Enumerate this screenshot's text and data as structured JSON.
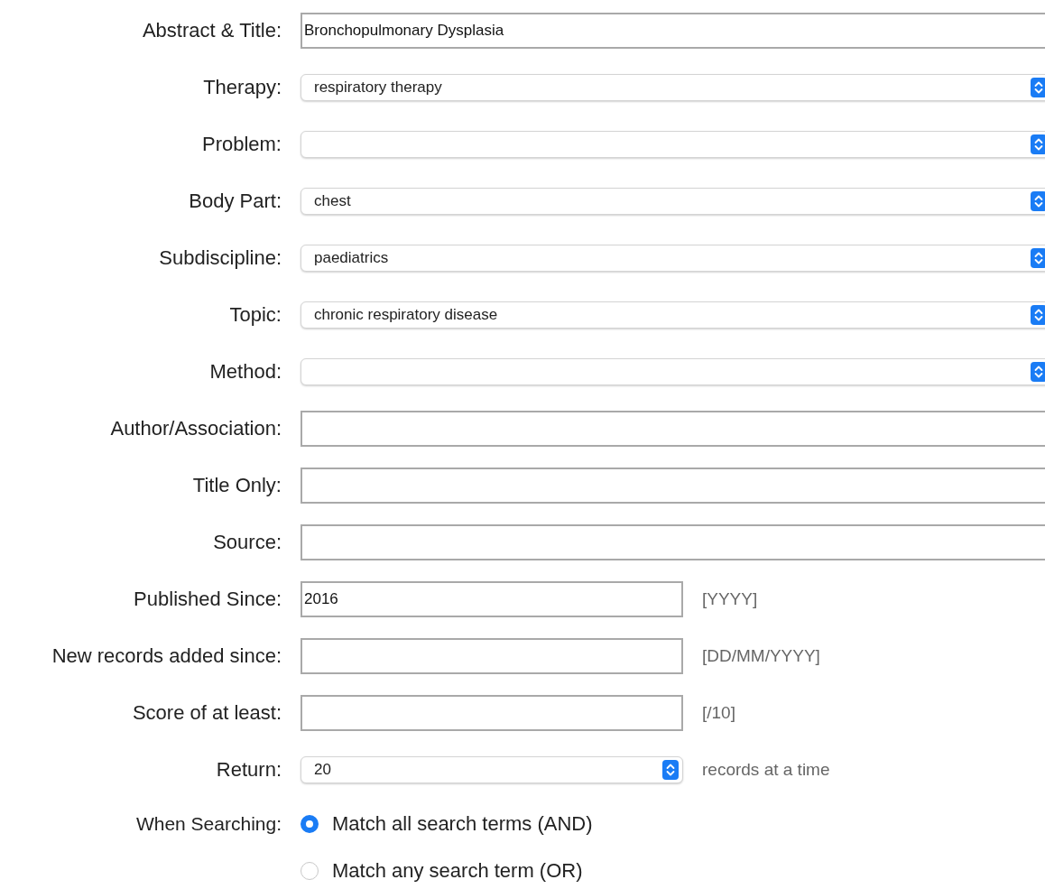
{
  "fields": [
    {
      "label": "Abstract & Title:",
      "kind": "text",
      "value": "Bronchopulmonary Dysplasia"
    },
    {
      "label": "Therapy:",
      "kind": "select",
      "value": "respiratory therapy"
    },
    {
      "label": "Problem:",
      "kind": "select"
    },
    {
      "label": "Body Part:",
      "kind": "select",
      "value": "chest"
    },
    {
      "label": "Subdiscipline:",
      "kind": "select",
      "value": "paediatrics"
    },
    {
      "label": "Topic:",
      "kind": "select",
      "value": "chronic respiratory disease"
    },
    {
      "label": "Method:",
      "kind": "select"
    },
    {
      "label": "Author/Association:",
      "kind": "text"
    },
    {
      "label": "Title Only:",
      "kind": "text"
    },
    {
      "label": "Source:",
      "kind": "text"
    },
    {
      "label": "Published Since:",
      "kind": "text",
      "value": "2016",
      "hint": "[YYYY]"
    },
    {
      "label": "New records added since:",
      "kind": "text",
      "hint": "[DD/MM/YYYY]"
    },
    {
      "label": "Score of at least:",
      "kind": "text",
      "hint": "[/10]"
    },
    {
      "label": "Return:",
      "kind": "select",
      "value": "20",
      "hint": "records at a time"
    }
  ],
  "search_mode": {
    "label": "When Searching:",
    "options": [
      {
        "label": "Match all search terms (AND)",
        "selected": true
      },
      {
        "label": "Match any search term (OR)",
        "selected": false
      }
    ]
  }
}
